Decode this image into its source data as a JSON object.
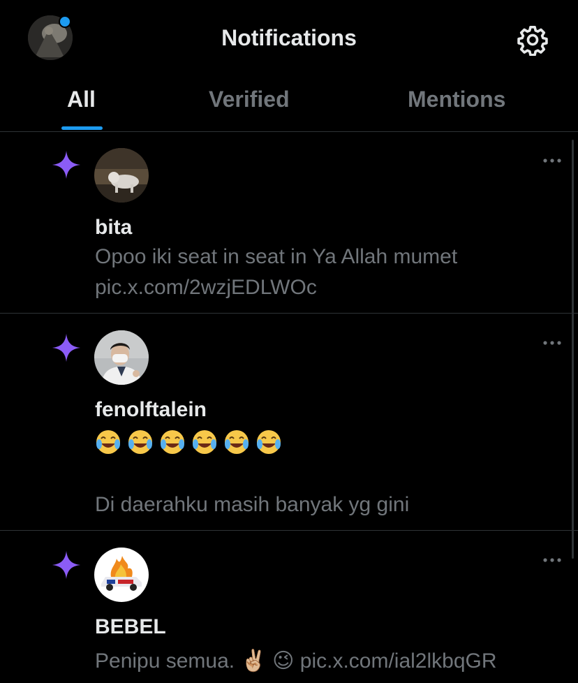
{
  "header": {
    "title": "Notifications",
    "avatar_icon": "profile-avatar",
    "settings_icon": "gear-icon"
  },
  "tabs": [
    {
      "label": "All",
      "active": true
    },
    {
      "label": "Verified",
      "active": false
    },
    {
      "label": "Mentions",
      "active": false
    }
  ],
  "notifications": [
    {
      "type": "sparkle-icon",
      "name": "bita",
      "lines": [
        "Opoo iki seat in seat in Ya Allah mumet",
        "pic.x.com/2wzjEDLWOc"
      ]
    },
    {
      "type": "sparkle-icon",
      "name": "fenolftalein",
      "emoji_line": "😂😂😂😂😂😂",
      "lines": [
        "Di daerahku masih banyak yg gini"
      ]
    },
    {
      "type": "sparkle-icon",
      "name": "BEBEL",
      "lines": [
        "Penipu semua. ✌🏼 😉 pic.x.com/ial2lkbqGR"
      ]
    }
  ],
  "colors": {
    "background": "#000000",
    "primary_text": "#e7e9ea",
    "secondary_text": "#71767b",
    "accent_blue": "#1d9bf0",
    "sparkle_purple": "#8b5cf6",
    "divider": "#2f3336"
  }
}
